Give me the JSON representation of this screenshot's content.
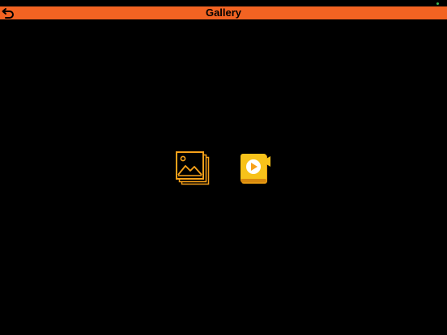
{
  "app": {
    "title": "Gallery"
  },
  "colors": {
    "header_bg": "#f26322",
    "icon_orange": "#f7a11a",
    "video_yellow": "#f7c21a",
    "status_dot": "#3cba54"
  },
  "icons": {
    "back": "back-arrow-icon",
    "photos": "photo-gallery-icon",
    "videos": "video-gallery-icon"
  }
}
